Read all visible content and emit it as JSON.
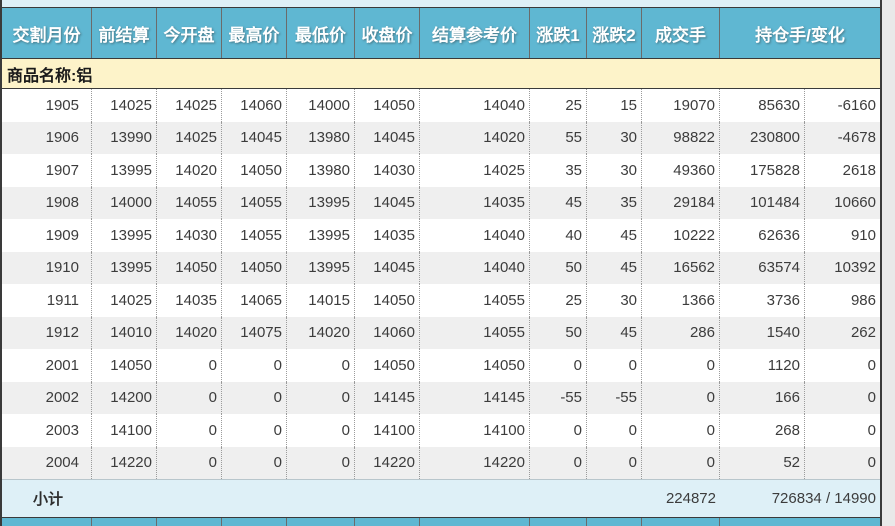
{
  "table": {
    "headers": [
      "交割月份",
      "前结算",
      "今开盘",
      "最高价",
      "最低价",
      "收盘价",
      "结算参考价",
      "涨跌1",
      "涨跌2",
      "成交手",
      "持仓手/变化"
    ],
    "product_label": "商品名称:铝",
    "rows": [
      [
        "1905",
        "14025",
        "14025",
        "14060",
        "14000",
        "14050",
        "14040",
        "25",
        "15",
        "19070",
        "85630",
        "-6160"
      ],
      [
        "1906",
        "13990",
        "14025",
        "14045",
        "13980",
        "14045",
        "14020",
        "55",
        "30",
        "98822",
        "230800",
        "-4678"
      ],
      [
        "1907",
        "13995",
        "14020",
        "14050",
        "13980",
        "14030",
        "14025",
        "35",
        "30",
        "49360",
        "175828",
        "2618"
      ],
      [
        "1908",
        "14000",
        "14055",
        "14055",
        "13995",
        "14045",
        "14035",
        "45",
        "35",
        "29184",
        "101484",
        "10660"
      ],
      [
        "1909",
        "13995",
        "14030",
        "14055",
        "13995",
        "14035",
        "14040",
        "40",
        "45",
        "10222",
        "62636",
        "910"
      ],
      [
        "1910",
        "13995",
        "14050",
        "14050",
        "13995",
        "14045",
        "14040",
        "50",
        "45",
        "16562",
        "63574",
        "10392"
      ],
      [
        "1911",
        "14025",
        "14035",
        "14065",
        "14015",
        "14050",
        "14055",
        "25",
        "30",
        "1366",
        "3736",
        "986"
      ],
      [
        "1912",
        "14010",
        "14020",
        "14075",
        "14020",
        "14060",
        "14055",
        "50",
        "45",
        "286",
        "1540",
        "262"
      ],
      [
        "2001",
        "14050",
        "0",
        "0",
        "0",
        "14050",
        "14050",
        "0",
        "0",
        "0",
        "1120",
        "0"
      ],
      [
        "2002",
        "14200",
        "0",
        "0",
        "0",
        "14145",
        "14145",
        "-55",
        "-55",
        "0",
        "166",
        "0"
      ],
      [
        "2003",
        "14100",
        "0",
        "0",
        "0",
        "14100",
        "14100",
        "0",
        "0",
        "0",
        "268",
        "0"
      ],
      [
        "2004",
        "14220",
        "0",
        "0",
        "0",
        "14220",
        "14220",
        "0",
        "0",
        "0",
        "52",
        "0"
      ]
    ],
    "footer": {
      "label": "小计",
      "volume": "224872",
      "open_interest_change": "726834 / 14990"
    }
  },
  "colors": {
    "header_bg": "#5fb7d2",
    "header_text": "#ffffff",
    "product_row_bg": "#fdf3c9",
    "row_bg": "#ffffff",
    "row_alt_bg": "#efefef",
    "subtotal_bg": "#def0f7",
    "text": "#3c3c3c",
    "outer_border": "#3a3a3a",
    "column_separator_dotted": "#9b9b9b"
  }
}
